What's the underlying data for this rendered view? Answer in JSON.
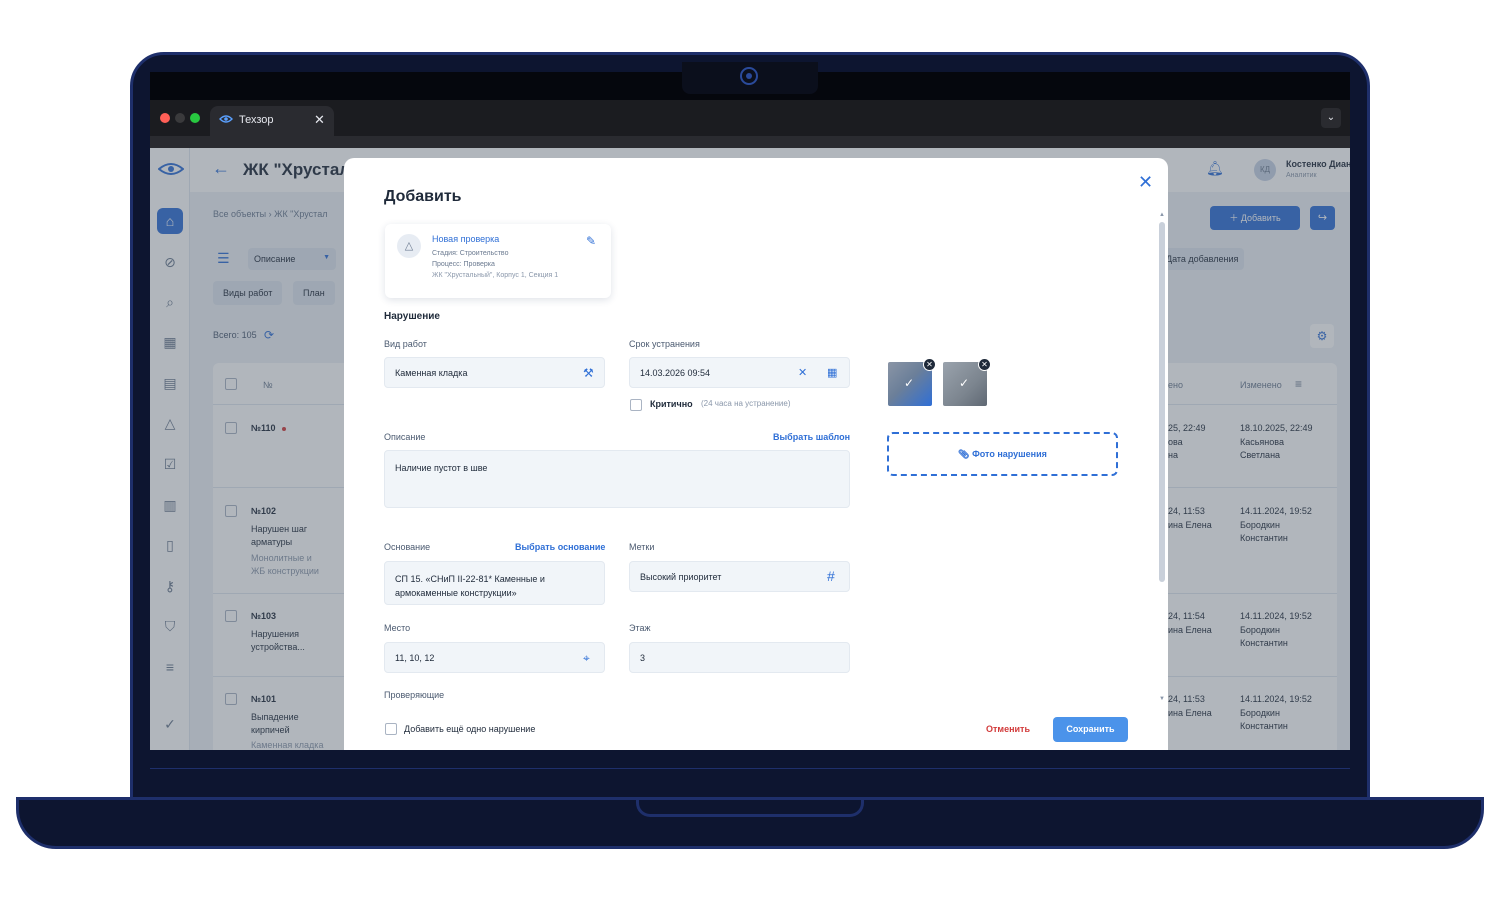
{
  "browser": {
    "tab_title": "Техзор",
    "close": "✕",
    "menu": "⌄"
  },
  "app": {
    "project_title": "ЖК \"Хрустал",
    "breadcrumb": "Все объекты   ›   ЖК \"Хрустал",
    "user": {
      "initials": "КД",
      "name": "Костенко Диана",
      "role": "Аналитик"
    },
    "add_button": "Добавить",
    "description_select": "Описание",
    "chips": [
      "Виды работ",
      "План"
    ],
    "date_chip": "Дата добавления",
    "total": "Всего: 105",
    "table": {
      "headers": {
        "number": "№",
        "changed_partial": "ено",
        "changed": "Изменено"
      },
      "rows": [
        {
          "num": "№110",
          "title": "",
          "subtitle": "",
          "changed_partial_1": "25, 22:49",
          "changed_partial_2": "ова",
          "changed_partial_3": "на",
          "changed_date": "18.10.2025, 22:49",
          "changed_by_1": "Касьянова",
          "changed_by_2": "Светлана"
        },
        {
          "num": "№102",
          "title": "Нарушен шаг",
          "title2": "арматуры",
          "subtitle": "Монолитные и",
          "subtitle2": "ЖБ конструкции",
          "changed_partial_1": "24, 11:53",
          "changed_partial_2": "ина Елена",
          "changed_date": "14.11.2024, 19:52",
          "changed_by_1": "Бородкин",
          "changed_by_2": "Константин"
        },
        {
          "num": "№103",
          "title": "Нарушения",
          "title2": "устройства...",
          "changed_partial_1": "24, 11:54",
          "changed_partial_2": "ина Елена",
          "changed_date": "14.11.2024, 19:52",
          "changed_by_1": "Бородкин",
          "changed_by_2": "Константин"
        },
        {
          "num": "№101",
          "title": "Выпадение",
          "title2": "кирпичей",
          "subtitle": "Каменная кладка",
          "changed_partial_1": "24, 11:53",
          "changed_partial_2": "ина Елена",
          "changed_date": "14.11.2024, 19:52",
          "changed_by_1": "Бородкин",
          "changed_by_2": "Константин"
        }
      ]
    }
  },
  "modal": {
    "title": "Добавить",
    "inspection": {
      "title": "Новая проверка",
      "stage": "Стадия: Строительство",
      "process": "Процесс: Проверка",
      "location": "ЖК \"Хрустальный\", Корпус 1, Секция 1"
    },
    "section_title": "Нарушение",
    "work_type": {
      "label": "Вид работ",
      "value": "Каменная кладка"
    },
    "deadline": {
      "label": "Срок устранения",
      "value": "14.03.2026 09:54"
    },
    "critical": {
      "label": "Критично",
      "hint": "(24 часа на устранение)"
    },
    "description": {
      "label": "Описание",
      "template_link": "Выбрать шаблон",
      "value": "Наличие пустот в шве"
    },
    "basis": {
      "label": "Основание",
      "link": "Выбрать основание",
      "value_line1": "СП 15. «СНиП II-22-81* Каменные и",
      "value_line2": "армокаменные конструкции»"
    },
    "tags": {
      "label": "Метки",
      "value": "Высокий приоритет"
    },
    "place": {
      "label": "Место",
      "value": "11, 10, 12"
    },
    "floor": {
      "label": "Этаж",
      "value": "3"
    },
    "inspectors": {
      "label": "Проверяющие"
    },
    "add_another": "Добавить ещё одно нарушение",
    "photo_button": "Фото нарушения",
    "cancel": "Отменить",
    "save": "Сохранить"
  },
  "colors": {
    "accent": "#2f6fd6",
    "danger": "#d23b3b",
    "frame": "#0d1530"
  }
}
